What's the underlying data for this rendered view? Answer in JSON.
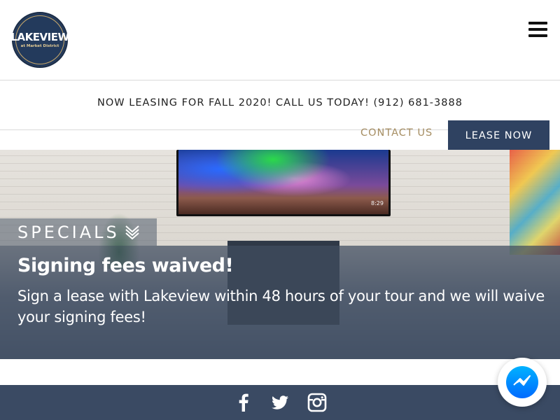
{
  "brand": {
    "logo_main": "LAKEVIEW",
    "logo_sub": "at Market District",
    "accent_navy": "#2f4261",
    "accent_gold": "#a68e63"
  },
  "header": {
    "menu_icon": "hamburger-menu-icon"
  },
  "announcement": {
    "text": "NOW LEASING FOR FALL 2020! CALL US TODAY! (912) 681-3888"
  },
  "nav": {
    "contact_label": "CONTACT US",
    "lease_label": "LEASE NOW"
  },
  "hero": {
    "tv_time": "8:29",
    "specials_heading": "SPECIALS",
    "specials_icon": "chevron-double-down-icon",
    "special_title": "Signing fees waived!",
    "special_body": "Sign a lease with Lakeview within 48 hours of your tour and we will waive your signing fees!"
  },
  "footer": {
    "social": [
      {
        "name": "facebook",
        "icon": "facebook-icon"
      },
      {
        "name": "twitter",
        "icon": "twitter-icon"
      },
      {
        "name": "instagram",
        "icon": "instagram-icon"
      }
    ]
  },
  "chat": {
    "icon": "messenger-icon"
  }
}
